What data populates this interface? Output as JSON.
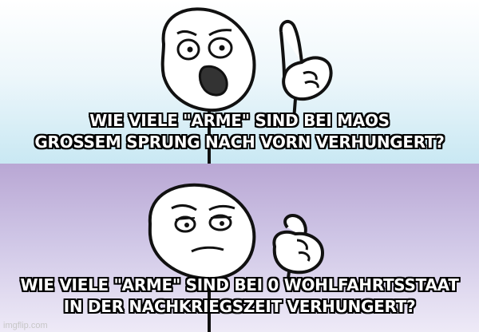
{
  "top_caption": {
    "line1": "WIE VIELE \"ARME\" SIND BEI MAOS",
    "line2": "GROSSEM SPRUNG NACH VORN VERHUNGERT?"
  },
  "bottom_caption": {
    "line1": "WIE VIELE \"ARME\" SIND BEI 0 WOHLFAHRTSSTAAT",
    "line2": "IN DER NACHKRIEGSZEIT VERHUNGERT?"
  },
  "watermark": "imgflip.com",
  "colors": {
    "top_bg_start": "#ffffff",
    "top_bg_end": "#c9e8f3",
    "bottom_bg_start": "#b9a7d4",
    "bottom_bg_end": "#eeeaf7",
    "caption_fill": "#ffffff",
    "caption_outline": "#000000"
  }
}
